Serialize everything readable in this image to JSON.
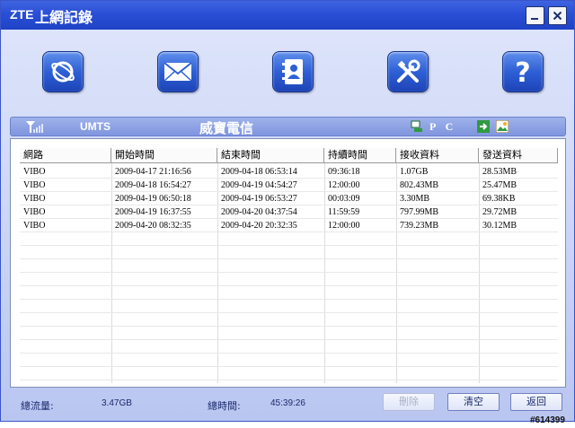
{
  "window": {
    "logo": "ZTE",
    "title": "上網記錄",
    "accent_color": "#2a4fd6"
  },
  "toolbar": {
    "buttons": [
      {
        "name": "internet",
        "icon": "globe-icon"
      },
      {
        "name": "sms",
        "icon": "envelope-icon"
      },
      {
        "name": "phonebook",
        "icon": "address-book-icon"
      },
      {
        "name": "settings",
        "icon": "tools-icon"
      },
      {
        "name": "help",
        "icon": "help-icon",
        "glyph": "?"
      }
    ]
  },
  "status": {
    "network_type": "UMTS",
    "carrier": "威寶電信",
    "mode": "P C"
  },
  "table": {
    "headers": [
      "網路",
      "開始時間",
      "結束時間",
      "持續時間",
      "接收資料",
      "發送資料"
    ],
    "rows": [
      [
        "VIBO",
        "2009-04-17  21:16:56",
        "2009-04-18  06:53:14",
        "09:36:18",
        "1.07GB",
        "28.53MB"
      ],
      [
        "VIBO",
        "2009-04-18  16:54:27",
        "2009-04-19  04:54:27",
        "12:00:00",
        "802.43MB",
        "25.47MB"
      ],
      [
        "VIBO",
        "2009-04-19  06:50:18",
        "2009-04-19  06:53:27",
        "00:03:09",
        "3.30MB",
        "69.38KB"
      ],
      [
        "VIBO",
        "2009-04-19  16:37:55",
        "2009-04-20  04:37:54",
        "11:59:59",
        "797.99MB",
        "29.72MB"
      ],
      [
        "VIBO",
        "2009-04-20  08:32:35",
        "2009-04-20  20:32:35",
        "12:00:00",
        "739.23MB",
        "30.12MB"
      ]
    ]
  },
  "footer": {
    "total_traffic_label": "總流量:",
    "total_traffic_value": "3.47GB",
    "total_time_label": "總時間:",
    "total_time_value": "45:39:26",
    "delete_label": "刪除",
    "clear_label": "清空",
    "back_label": "返回"
  },
  "watermark": "#614399"
}
